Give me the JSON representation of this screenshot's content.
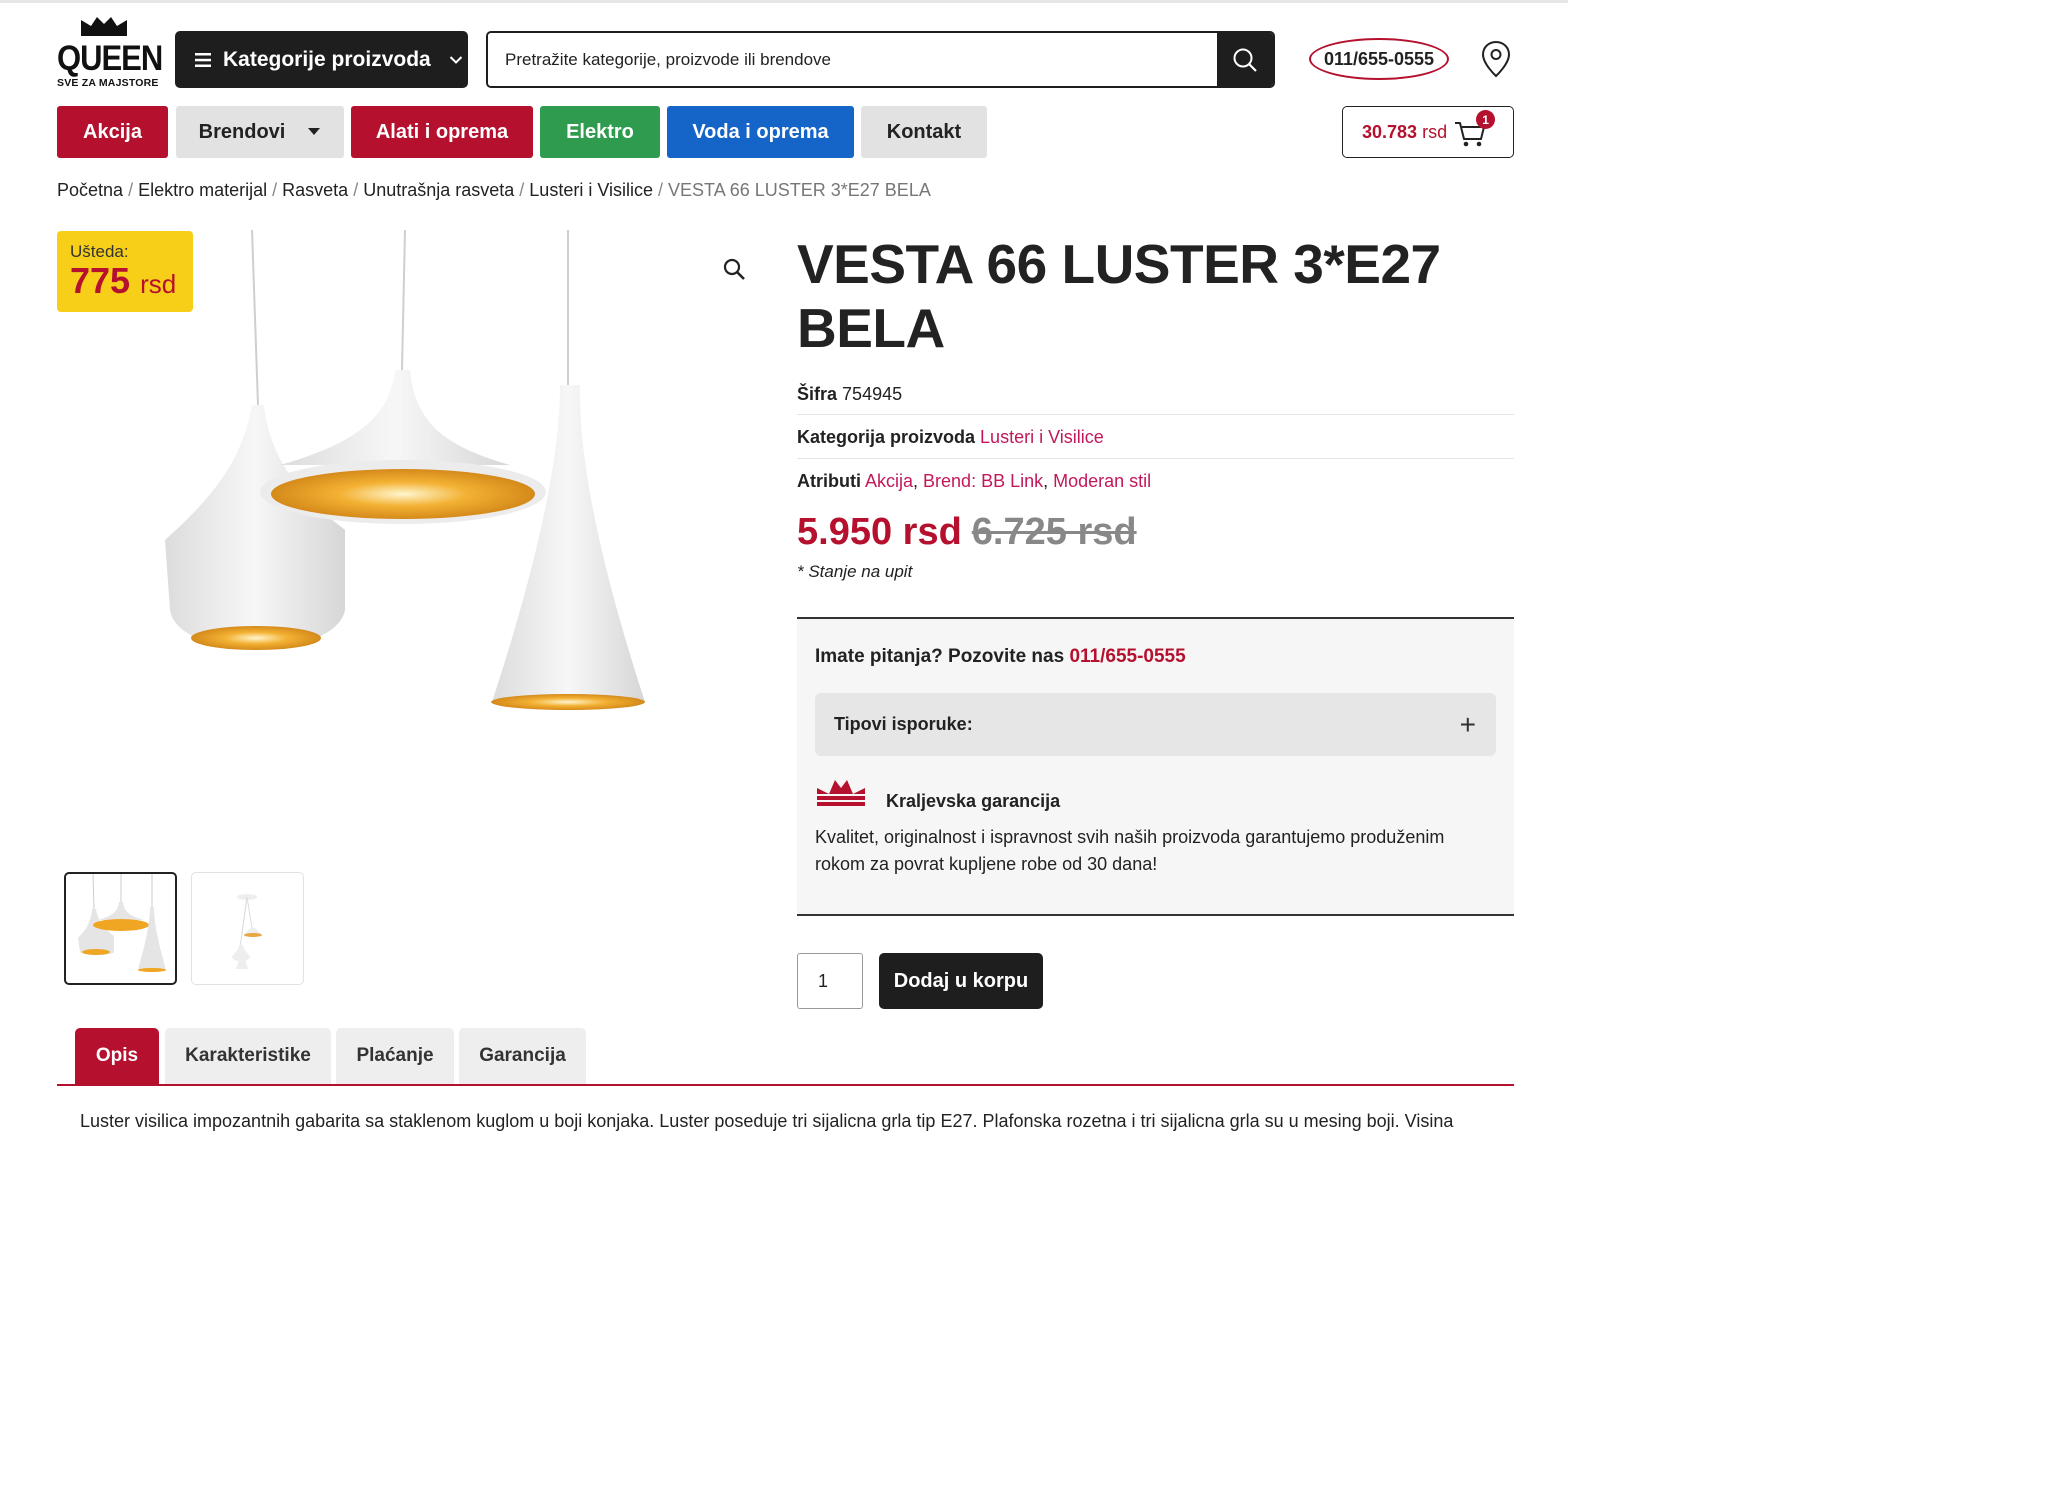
{
  "header": {
    "logo_word": "QUEEN",
    "logo_tagline": "SVE ZA MAJSTORE",
    "categories_button": "Kategorije proizvoda",
    "search_placeholder": "Pretražite kategorije, proizvode ili brendove",
    "phone": "011/655-0555"
  },
  "nav": {
    "akcija": "Akcija",
    "brendovi": "Brendovi",
    "alati": "Alati i oprema",
    "elektro": "Elektro",
    "voda": "Voda i oprema",
    "kontakt": "Kontakt"
  },
  "cart": {
    "amount": "30.783",
    "currency": "rsd",
    "count": "1"
  },
  "breadcrumb": [
    "Početna",
    "Elektro materijal",
    "Rasveta",
    "Unutrašnja rasveta",
    "Lusteri i Visilice",
    "VESTA 66 LUSTER 3*E27 BELA"
  ],
  "savings": {
    "label": "Ušteda:",
    "value": "775",
    "currency": "rsd"
  },
  "product": {
    "title": "VESTA 66 LUSTER 3*E27 BELA",
    "sku_label": "Šifra",
    "sku": "754945",
    "category_label": "Kategorija proizvoda",
    "category": "Lusteri i Visilice",
    "attributes_label": "Atributi",
    "attributes": [
      "Akcija",
      "Brend: BB Link",
      "Moderan stil"
    ],
    "price": "5.950 rsd",
    "old_price": "6.725 rsd",
    "stock": "* Stanje na upit"
  },
  "info": {
    "question": "Imate pitanja? Pozovite nas",
    "phone": "011/655-0555",
    "delivery_types": "Tipovi isporuke:",
    "guarantee_title": "Kraljevska garancija",
    "guarantee_text": "Kvalitet, originalnost i ispravnost svih naših proizvoda garantujemo produženim rokom za povrat kupljene robe od 30 dana!"
  },
  "purchase": {
    "quantity": "1",
    "add_to_cart": "Dodaj u korpu"
  },
  "tabs": [
    "Opis",
    "Karakteristike",
    "Plaćanje",
    "Garancija"
  ],
  "description": "Luster visilica impozantnih gabarita sa staklenom kuglom u boji konjaka. Luster poseduje tri sijalicna grla tip E27. Plafonska rozetna i tri sijalicna grla su u mesing boji. Visina",
  "colors": {
    "brand_red": "#b5102e",
    "green": "#2e9b4f",
    "blue": "#1565c8",
    "yellow": "#f7cf19",
    "link_pink": "#c2185b"
  }
}
